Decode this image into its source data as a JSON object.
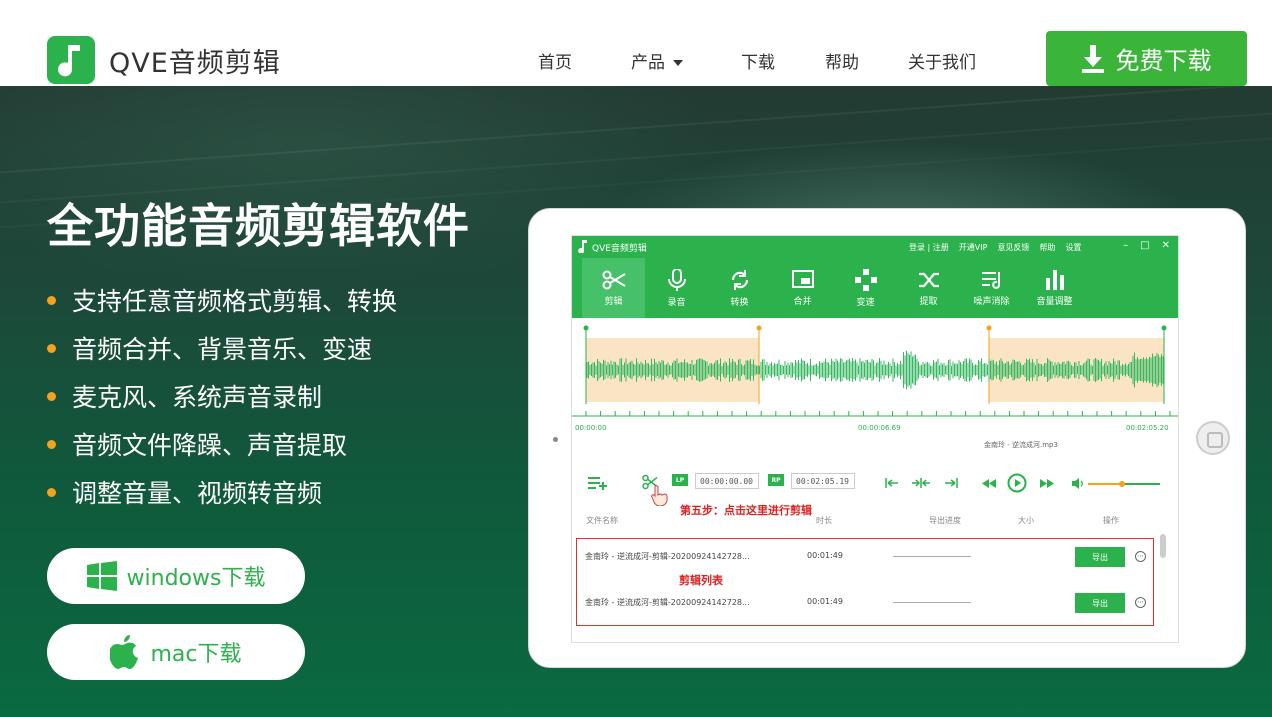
{
  "brand": {
    "name": "QVE音频剪辑",
    "color": "#2bb24c"
  },
  "nav": {
    "items": [
      {
        "label": "首页"
      },
      {
        "label": "产品"
      },
      {
        "label": "下载"
      },
      {
        "label": "帮助"
      },
      {
        "label": "关于我们"
      }
    ],
    "download_label": "免费下载"
  },
  "hero": {
    "title": "全功能音频剪辑软件",
    "features": [
      "支持任意音频格式剪辑、转换",
      "音频合并、背景音乐、变速",
      "麦克风、系统声音录制",
      "音频文件降躁、声音提取",
      "调整音量、视频转音频"
    ],
    "windows_label": "windows下载",
    "mac_label": "mac下载"
  },
  "app": {
    "title": "QVE音频剪辑",
    "top_links": [
      "登录 | 注册",
      "开通VIP",
      "意见反馈",
      "帮助",
      "设置"
    ],
    "tools": [
      {
        "label": "剪辑",
        "icon": "scissors-icon"
      },
      {
        "label": "录音",
        "icon": "microphone-icon"
      },
      {
        "label": "转换",
        "icon": "convert-icon"
      },
      {
        "label": "合并",
        "icon": "merge-icon"
      },
      {
        "label": "变速",
        "icon": "speed-icon"
      },
      {
        "label": "提取",
        "icon": "extract-icon"
      },
      {
        "label": "噪声消除",
        "icon": "denoise-icon"
      },
      {
        "label": "音量调整",
        "icon": "volume-bars-icon"
      }
    ],
    "timeline": {
      "start": "00:00:00",
      "mid": "00:00:06.69",
      "end": "00:02:05.20"
    },
    "filename": "金南玲 - 逆流成河.mp3",
    "start_time": "00:00:00.00",
    "end_time": "00:02:05.19",
    "lp_label": "LP",
    "rp_label": "RP",
    "hint": "第五步：点击这里进行剪辑",
    "columns": [
      "文件名称",
      "时长",
      "导出进度",
      "大小",
      "操作"
    ],
    "rows": [
      {
        "name": "金南玲 - 逆流成河-剪辑-20200924142728...",
        "duration": "00:01:49",
        "action": "导出"
      },
      {
        "name": "金南玲 - 逆流成河-剪辑-20200924142728...",
        "duration": "00:01:49",
        "action": "导出"
      }
    ],
    "list_label": "剪辑列表"
  }
}
